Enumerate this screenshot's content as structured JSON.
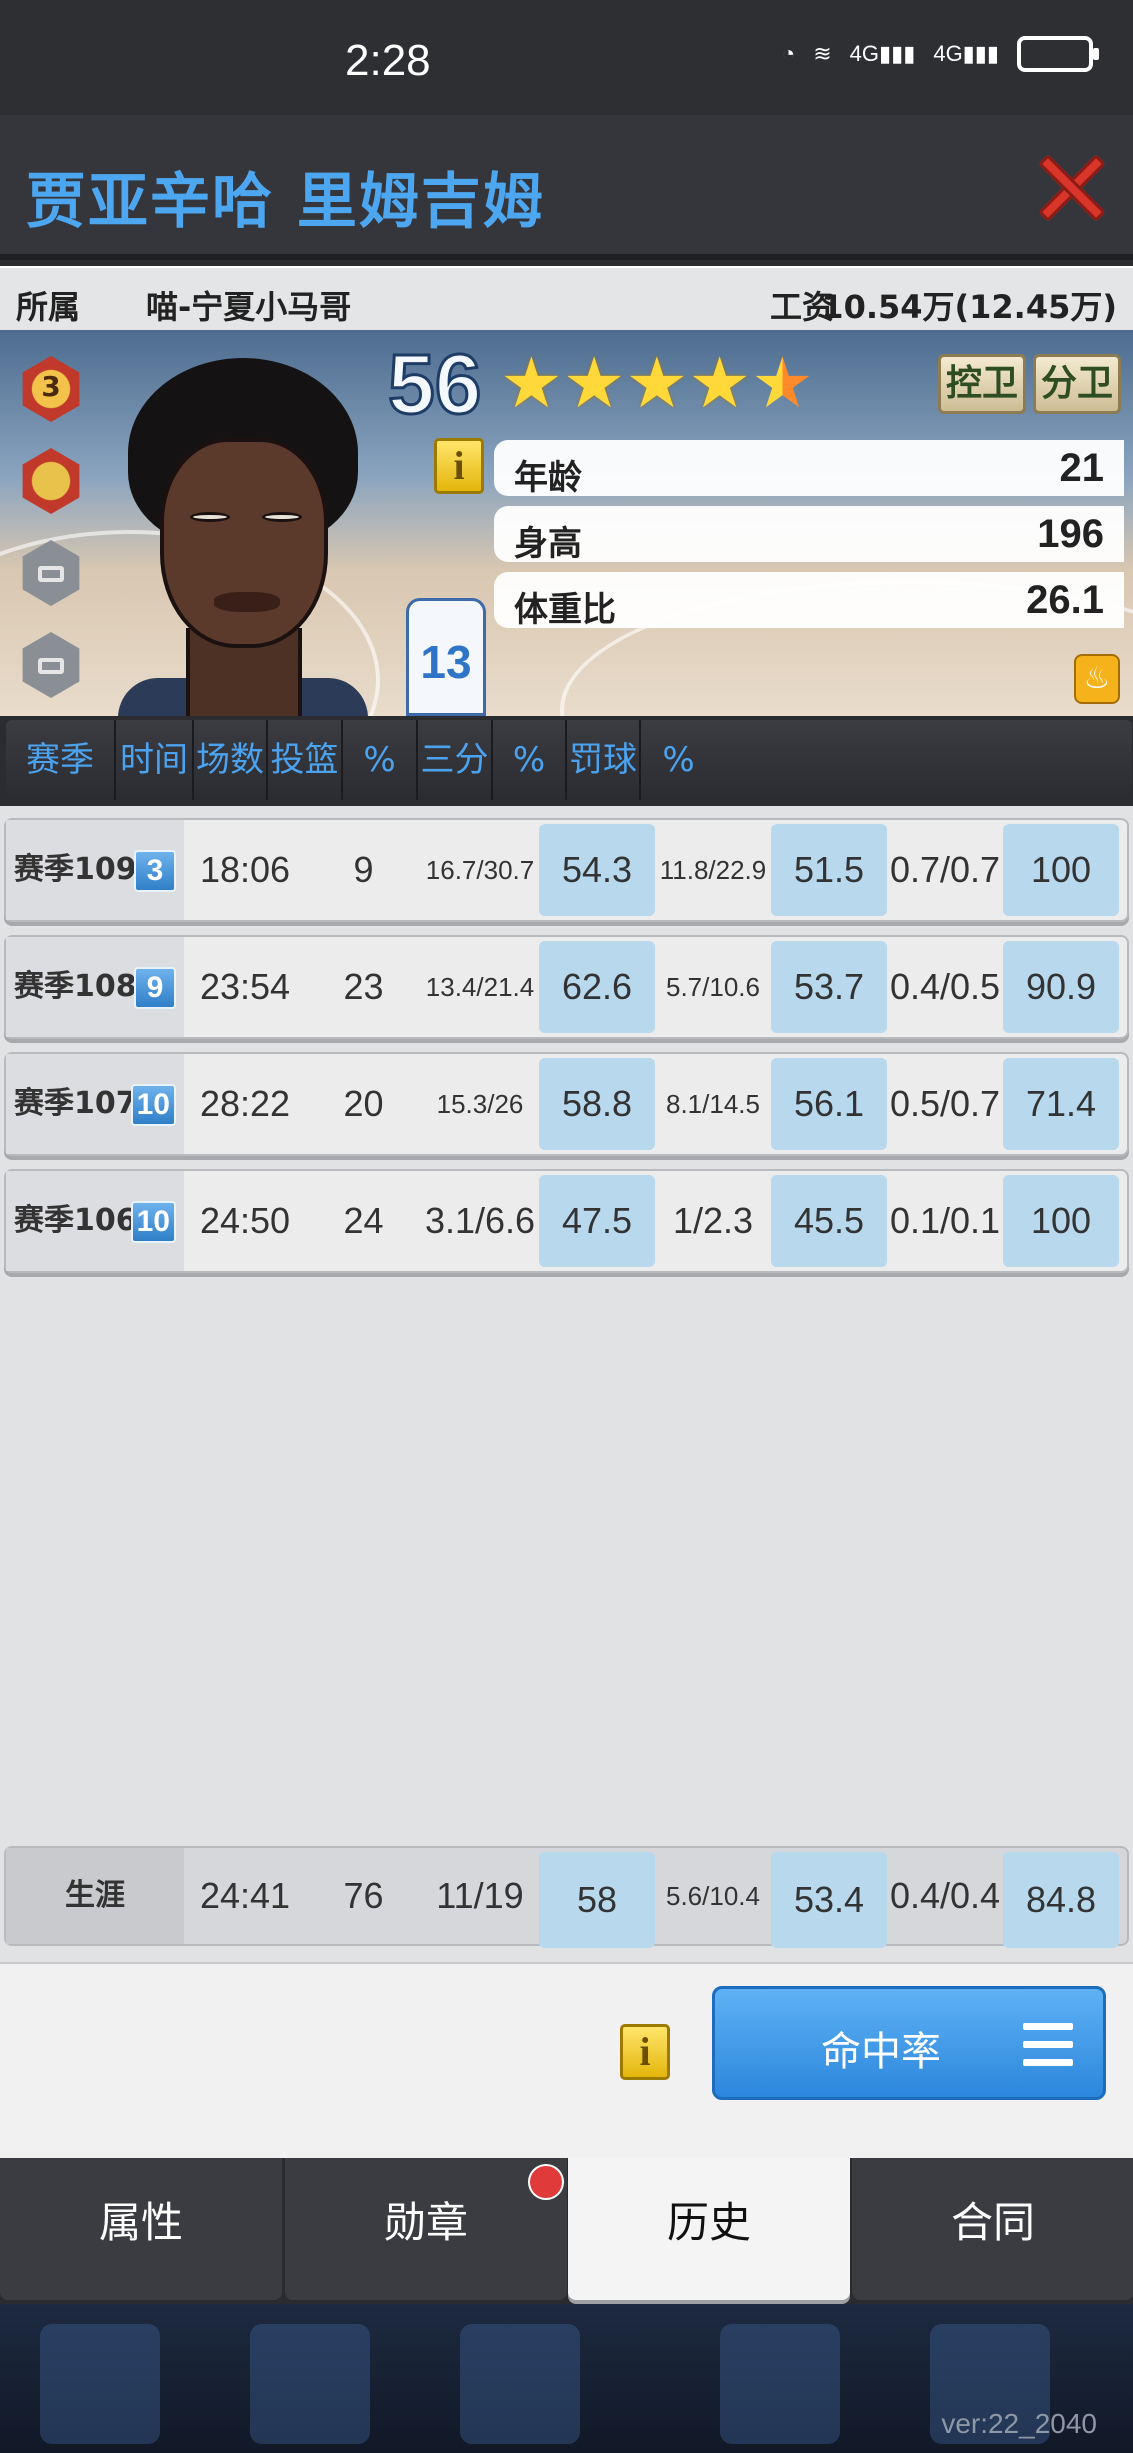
{
  "status_bar": {
    "time": "2:28",
    "icons": [
      "speed-icon",
      "wifi-icon",
      "signal-4g-icon",
      "signal-4g-icon",
      "battery-charging-icon"
    ]
  },
  "title_bar": {
    "player_name": "贾亚辛哈 里姆吉姆",
    "close_icon": "close-icon"
  },
  "info_row": {
    "team_label": "所属",
    "team": "喵-宁夏小马哥",
    "salary_label": "工资",
    "salary": "10.54万(12.45万)"
  },
  "card": {
    "rating": "56",
    "stars": 4.5,
    "positions": [
      "控卫",
      "分卫"
    ],
    "badge_level": "3",
    "jersey_number": "13",
    "info_icon_label": "i",
    "attributes": [
      {
        "label": "年龄",
        "value": "21"
      },
      {
        "label": "身高",
        "value": "196"
      },
      {
        "label": "体重比",
        "value": "26.1"
      }
    ]
  },
  "table": {
    "headers": [
      "赛季",
      "时间",
      "场数",
      "投篮",
      "%",
      "三分",
      "%",
      "罚球",
      "%"
    ],
    "rows": [
      {
        "season": "赛季109",
        "level": "3",
        "time": "18:06",
        "games": "9",
        "fg": "16.7/30.7",
        "fg_pct": "54.3",
        "three": "11.8/22.9",
        "three_pct": "51.5",
        "ft": "0.7/0.7",
        "ft_pct": "100"
      },
      {
        "season": "赛季108",
        "level": "9",
        "time": "23:54",
        "games": "23",
        "fg": "13.4/21.4",
        "fg_pct": "62.6",
        "three": "5.7/10.6",
        "three_pct": "53.7",
        "ft": "0.4/0.5",
        "ft_pct": "90.9"
      },
      {
        "season": "赛季107",
        "level": "10",
        "time": "28:22",
        "games": "20",
        "fg": "15.3/26",
        "fg_pct": "58.8",
        "three": "8.1/14.5",
        "three_pct": "56.1",
        "ft": "0.5/0.7",
        "ft_pct": "71.4"
      },
      {
        "season": "赛季106",
        "level": "10",
        "time": "24:50",
        "games": "24",
        "fg": "3.1/6.6",
        "fg_pct": "47.5",
        "three": "1/2.3",
        "three_pct": "45.5",
        "ft": "0.1/0.1",
        "ft_pct": "100"
      }
    ],
    "career": {
      "label": "生涯",
      "time": "24:41",
      "games": "76",
      "fg": "11/19",
      "fg_pct": "58",
      "three": "5.6/10.4",
      "three_pct": "53.4",
      "ft": "0.4/0.4",
      "ft_pct": "84.8"
    }
  },
  "action": {
    "info_icon_label": "i",
    "hit_rate_button": "命中率",
    "menu_icon": "menu-icon"
  },
  "tabs": [
    {
      "label": "属性",
      "active": false
    },
    {
      "label": "勋章",
      "active": false,
      "notification": true
    },
    {
      "label": "历史",
      "active": true
    },
    {
      "label": "合同",
      "active": false
    }
  ],
  "footer": {
    "version": "ver:22_2040"
  }
}
